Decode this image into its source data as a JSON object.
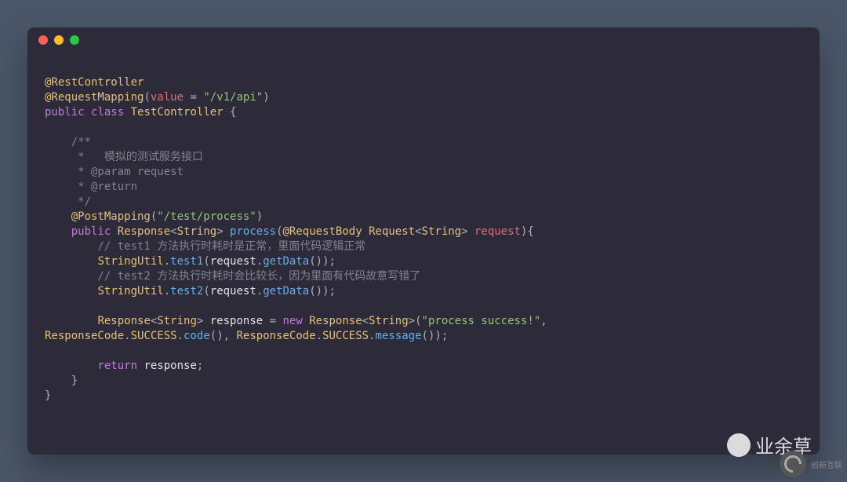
{
  "code": {
    "l1": {
      "a": "@RestController"
    },
    "l2": {
      "a": "@RequestMapping",
      "p1": "(",
      "k": "value",
      "eq": " = ",
      "s": "\"/v1/api\"",
      "p2": ")"
    },
    "l3": {
      "k1": "public",
      "k2": "class",
      "cls": "TestController",
      "b": " {"
    },
    "l5": {
      "c": "    /**"
    },
    "l6": {
      "c": "     *   模拟的测试服务接口"
    },
    "l7": {
      "c": "     * @param request"
    },
    "l8": {
      "c": "     * @return"
    },
    "l9": {
      "c": "     */"
    },
    "l10": {
      "a": "    @PostMapping",
      "p1": "(",
      "s": "\"/test/process\"",
      "p2": ")"
    },
    "l11": {
      "k1": "    public",
      "t1": "Response",
      "lt1": "<",
      "t2": "String",
      "gt1": "> ",
      "m": "process",
      "p1": "(",
      "a": "@RequestBody",
      "t3": " Request",
      "lt2": "<",
      "t4": "String",
      "gt2": "> ",
      "v": "request",
      "p2": "){"
    },
    "l12": {
      "c": "        // test1 方法执行时耗时是正常，里面代码逻辑正常"
    },
    "l13": {
      "i": "        ",
      "cls": "StringUtil",
      "d1": ".",
      "m1": "test1",
      "p1": "(",
      "v": "request",
      "d2": ".",
      "m2": "getData",
      "p2": "());"
    },
    "l14": {
      "c": "        // test2 方法执行时耗时会比较长，因为里面有代码故意写错了"
    },
    "l15": {
      "i": "        ",
      "cls": "StringUtil",
      "d1": ".",
      "m1": "test2",
      "p1": "(",
      "v": "request",
      "d2": ".",
      "m2": "getData",
      "p2": "());"
    },
    "l17a": {
      "i": "        ",
      "t1": "Response",
      "lt1": "<",
      "t2": "String",
      "gt1": "> ",
      "v": "response",
      "eq": " = ",
      "k": "new",
      "t3": " Response",
      "lt2": "<",
      "t4": "String",
      "gt2": ">",
      "p1": "(",
      "s": "\"process success!\"",
      "p2": ", "
    },
    "l17b": {
      "cls1": "ResponseCode",
      "d1": ".",
      "c1": "SUCCESS",
      "d2": ".",
      "m1": "code",
      "p1": "(), ",
      "cls2": "ResponseCode",
      "d3": ".",
      "c2": "SUCCESS",
      "d4": ".",
      "m2": "message",
      "p2": "());"
    },
    "l19": {
      "k": "        return",
      "v": " response",
      "p": ";"
    },
    "l20": {
      "b": "    }"
    },
    "l21": {
      "b": "}"
    }
  },
  "watermark": {
    "wechat": "业余草",
    "logo": "创新互联"
  }
}
